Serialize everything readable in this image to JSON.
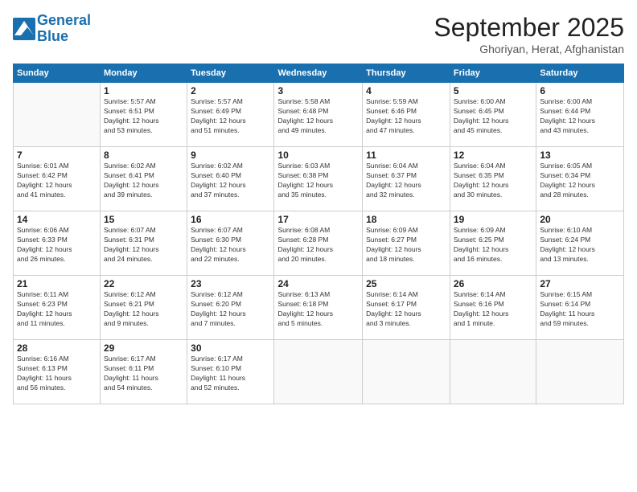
{
  "header": {
    "logo_line1": "General",
    "logo_line2": "Blue",
    "month_title": "September 2025",
    "subtitle": "Ghoriyan, Herat, Afghanistan"
  },
  "weekdays": [
    "Sunday",
    "Monday",
    "Tuesday",
    "Wednesday",
    "Thursday",
    "Friday",
    "Saturday"
  ],
  "weeks": [
    [
      {
        "day": "",
        "info": ""
      },
      {
        "day": "1",
        "info": "Sunrise: 5:57 AM\nSunset: 6:51 PM\nDaylight: 12 hours\nand 53 minutes."
      },
      {
        "day": "2",
        "info": "Sunrise: 5:57 AM\nSunset: 6:49 PM\nDaylight: 12 hours\nand 51 minutes."
      },
      {
        "day": "3",
        "info": "Sunrise: 5:58 AM\nSunset: 6:48 PM\nDaylight: 12 hours\nand 49 minutes."
      },
      {
        "day": "4",
        "info": "Sunrise: 5:59 AM\nSunset: 6:46 PM\nDaylight: 12 hours\nand 47 minutes."
      },
      {
        "day": "5",
        "info": "Sunrise: 6:00 AM\nSunset: 6:45 PM\nDaylight: 12 hours\nand 45 minutes."
      },
      {
        "day": "6",
        "info": "Sunrise: 6:00 AM\nSunset: 6:44 PM\nDaylight: 12 hours\nand 43 minutes."
      }
    ],
    [
      {
        "day": "7",
        "info": "Sunrise: 6:01 AM\nSunset: 6:42 PM\nDaylight: 12 hours\nand 41 minutes."
      },
      {
        "day": "8",
        "info": "Sunrise: 6:02 AM\nSunset: 6:41 PM\nDaylight: 12 hours\nand 39 minutes."
      },
      {
        "day": "9",
        "info": "Sunrise: 6:02 AM\nSunset: 6:40 PM\nDaylight: 12 hours\nand 37 minutes."
      },
      {
        "day": "10",
        "info": "Sunrise: 6:03 AM\nSunset: 6:38 PM\nDaylight: 12 hours\nand 35 minutes."
      },
      {
        "day": "11",
        "info": "Sunrise: 6:04 AM\nSunset: 6:37 PM\nDaylight: 12 hours\nand 32 minutes."
      },
      {
        "day": "12",
        "info": "Sunrise: 6:04 AM\nSunset: 6:35 PM\nDaylight: 12 hours\nand 30 minutes."
      },
      {
        "day": "13",
        "info": "Sunrise: 6:05 AM\nSunset: 6:34 PM\nDaylight: 12 hours\nand 28 minutes."
      }
    ],
    [
      {
        "day": "14",
        "info": "Sunrise: 6:06 AM\nSunset: 6:33 PM\nDaylight: 12 hours\nand 26 minutes."
      },
      {
        "day": "15",
        "info": "Sunrise: 6:07 AM\nSunset: 6:31 PM\nDaylight: 12 hours\nand 24 minutes."
      },
      {
        "day": "16",
        "info": "Sunrise: 6:07 AM\nSunset: 6:30 PM\nDaylight: 12 hours\nand 22 minutes."
      },
      {
        "day": "17",
        "info": "Sunrise: 6:08 AM\nSunset: 6:28 PM\nDaylight: 12 hours\nand 20 minutes."
      },
      {
        "day": "18",
        "info": "Sunrise: 6:09 AM\nSunset: 6:27 PM\nDaylight: 12 hours\nand 18 minutes."
      },
      {
        "day": "19",
        "info": "Sunrise: 6:09 AM\nSunset: 6:25 PM\nDaylight: 12 hours\nand 16 minutes."
      },
      {
        "day": "20",
        "info": "Sunrise: 6:10 AM\nSunset: 6:24 PM\nDaylight: 12 hours\nand 13 minutes."
      }
    ],
    [
      {
        "day": "21",
        "info": "Sunrise: 6:11 AM\nSunset: 6:23 PM\nDaylight: 12 hours\nand 11 minutes."
      },
      {
        "day": "22",
        "info": "Sunrise: 6:12 AM\nSunset: 6:21 PM\nDaylight: 12 hours\nand 9 minutes."
      },
      {
        "day": "23",
        "info": "Sunrise: 6:12 AM\nSunset: 6:20 PM\nDaylight: 12 hours\nand 7 minutes."
      },
      {
        "day": "24",
        "info": "Sunrise: 6:13 AM\nSunset: 6:18 PM\nDaylight: 12 hours\nand 5 minutes."
      },
      {
        "day": "25",
        "info": "Sunrise: 6:14 AM\nSunset: 6:17 PM\nDaylight: 12 hours\nand 3 minutes."
      },
      {
        "day": "26",
        "info": "Sunrise: 6:14 AM\nSunset: 6:16 PM\nDaylight: 12 hours\nand 1 minute."
      },
      {
        "day": "27",
        "info": "Sunrise: 6:15 AM\nSunset: 6:14 PM\nDaylight: 11 hours\nand 59 minutes."
      }
    ],
    [
      {
        "day": "28",
        "info": "Sunrise: 6:16 AM\nSunset: 6:13 PM\nDaylight: 11 hours\nand 56 minutes."
      },
      {
        "day": "29",
        "info": "Sunrise: 6:17 AM\nSunset: 6:11 PM\nDaylight: 11 hours\nand 54 minutes."
      },
      {
        "day": "30",
        "info": "Sunrise: 6:17 AM\nSunset: 6:10 PM\nDaylight: 11 hours\nand 52 minutes."
      },
      {
        "day": "",
        "info": ""
      },
      {
        "day": "",
        "info": ""
      },
      {
        "day": "",
        "info": ""
      },
      {
        "day": "",
        "info": ""
      }
    ]
  ]
}
